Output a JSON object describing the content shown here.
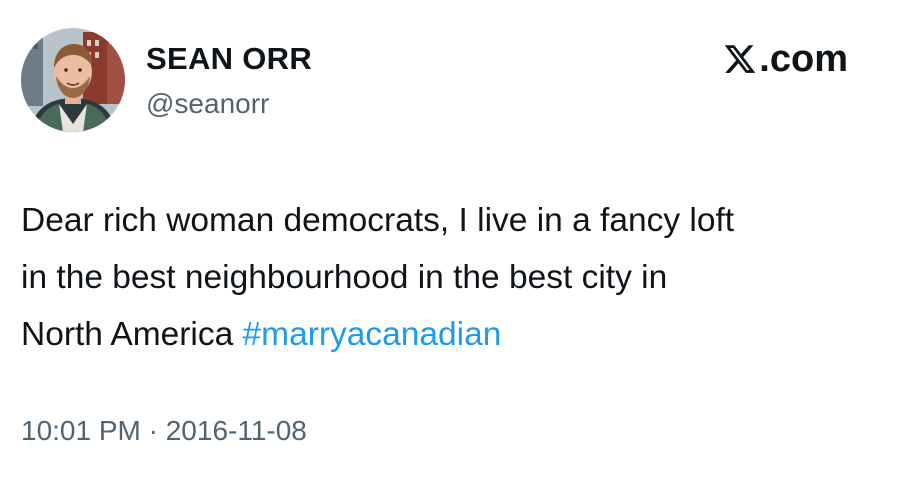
{
  "author": {
    "display_name": "SEAN ORR",
    "handle": "@seanorr"
  },
  "site": {
    "label": ".com",
    "logo_icon": "x-logo-icon"
  },
  "tweet": {
    "text_line1": "Dear rich woman democrats, I live in a fancy loft",
    "text_line2": "in the best neighbourhood in the best city in",
    "text_line3_prefix": "North America ",
    "hashtag": "#marryacanadian"
  },
  "meta": {
    "timestamp": "10:01 PM · 2016-11-08"
  },
  "colors": {
    "text": "#0f1419",
    "secondary": "#536471",
    "link": "#1d9bf0",
    "background": "#ffffff"
  }
}
